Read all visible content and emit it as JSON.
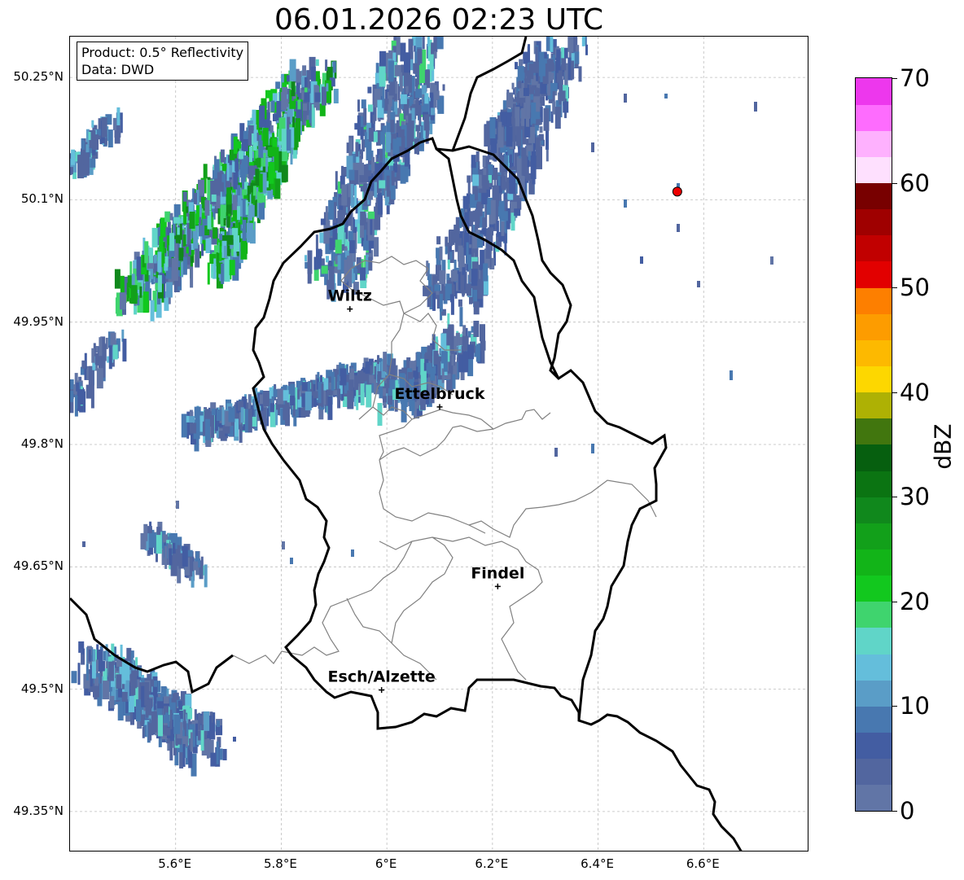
{
  "title": "06.01.2026 02:23 UTC",
  "info_box": {
    "product": "Product: 0.5° Reflectivity",
    "data": "Data: DWD"
  },
  "lat_labels": [
    "50.25°N",
    "50.1°N",
    "49.95°N",
    "49.8°N",
    "49.65°N",
    "49.5°N",
    "49.35°N"
  ],
  "lon_labels": [
    "5.6°E",
    "5.8°E",
    "6°E",
    "6.2°E",
    "6.4°E",
    "6.6°E"
  ],
  "cities": [
    {
      "name": "Wiltz",
      "lon": 5.93,
      "lat": 49.966
    },
    {
      "name": "Ettelbruck",
      "lon": 6.1,
      "lat": 49.846
    },
    {
      "name": "Findel",
      "lon": 6.21,
      "lat": 49.626
    },
    {
      "name": "Esch/Alzette",
      "lon": 5.99,
      "lat": 49.499
    }
  ],
  "marker": {
    "lon": 6.55,
    "lat": 50.11,
    "color": "#ee0000"
  },
  "colorbar": {
    "label": "dBZ",
    "min": 0,
    "max": 70,
    "step": 2.5,
    "ticks": [
      "0",
      "10",
      "20",
      "30",
      "40",
      "50",
      "60",
      "70"
    ],
    "colors": [
      "#6175a6",
      "#52669f",
      "#435da2",
      "#4878b0",
      "#5a9dc7",
      "#64bedb",
      "#60d5c8",
      "#3fd46e",
      "#12c81e",
      "#12b418",
      "#12a01a",
      "#10881c",
      "#0b7412",
      "#065f0f",
      "#41760e",
      "#aeb104",
      "#fdd700",
      "#fdb900",
      "#fd9c00",
      "#fd7f00",
      "#e20000",
      "#c10000",
      "#9f0000",
      "#780000",
      "#fee0fe",
      "#feb1fe",
      "#fe6cfe",
      "#ed37ed"
    ]
  }
}
